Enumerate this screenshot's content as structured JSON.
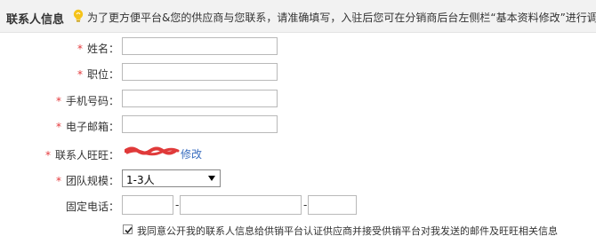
{
  "section": {
    "title": "联系人信息",
    "hint": "为了更方便平台&您的供应商与您联系，请准确填写，入驻后您可在分销商后台左侧栏“基本资料修改”进行调整"
  },
  "form": {
    "required_mark": "*",
    "name_label": "姓名：",
    "name_value": "",
    "position_label": "职位：",
    "position_value": "",
    "mobile_label": "手机号码：",
    "mobile_value": "",
    "email_label": "电子邮箱：",
    "email_value": "",
    "wangwang_label": "联系人旺旺：",
    "wangwang_modify": "修改",
    "team_label": "团队规模：",
    "team_value": "1-3人",
    "phone_label": "固定电话：",
    "phone_sep1": "-",
    "phone_sep2": "-",
    "agree_checked": true,
    "agree_text": "我同意公开我的联系人信息给供销平台认证供应商并接受供销平台对我发送的邮件及旺旺相关信息"
  },
  "colors": {
    "required": "#e4393c",
    "link": "#3a6ebf",
    "hint_icon": "#f5c31a",
    "redaction": "#e03a3a"
  },
  "icons": {
    "hint": "lightbulb-icon",
    "select": "dropdown-arrow-icon",
    "checkbox": "checkmark-icon"
  }
}
